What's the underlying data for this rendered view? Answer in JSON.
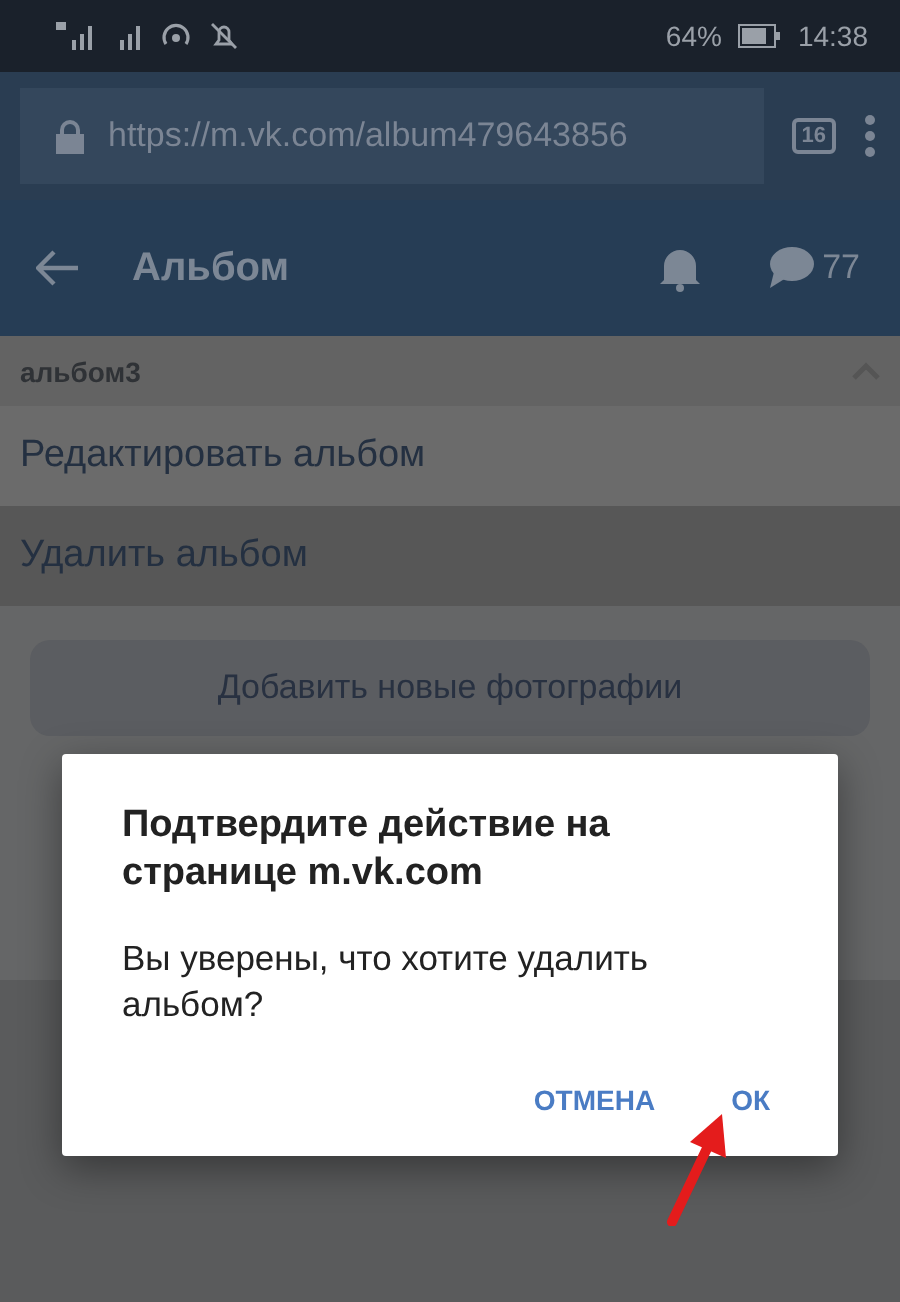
{
  "status_bar": {
    "battery": "64%",
    "time": "14:38"
  },
  "browser": {
    "url": "https://m.vk.com/album479643856",
    "tabs_count": "16"
  },
  "header": {
    "title": "Альбом",
    "messages_count": "77"
  },
  "album": {
    "name": "альбом3",
    "expanded": true,
    "actions": [
      {
        "label": "Редактировать альбом",
        "selected": false
      },
      {
        "label": "Удалить альбом",
        "selected": true
      }
    ],
    "add_button": "Добавить новые фотографии"
  },
  "dialog": {
    "title": "Подтвердите действие на странице m.vk.com",
    "message": "Вы уверены, что хотите удалить альбом?",
    "buttons": [
      {
        "label": "ОТМЕНА"
      },
      {
        "label": "ОК"
      }
    ]
  }
}
